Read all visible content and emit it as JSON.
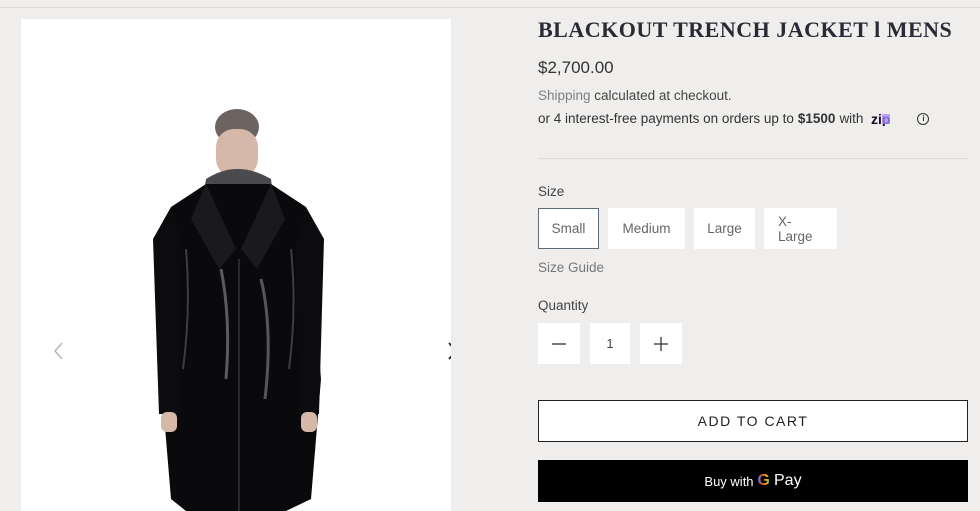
{
  "product": {
    "title": "BLACKOUT TRENCH JACKET l MENS",
    "price": "$2,700.00",
    "shipping_link": "Shipping",
    "shipping_text": " calculated at checkout.",
    "zip_prefix": "or 4 interest-free payments on orders up to",
    "zip_amount": "$1500",
    "zip_suffix": "with",
    "zip_brand": "zip"
  },
  "size": {
    "label": "Size",
    "options": [
      "Small",
      "Medium",
      "Large",
      "X-Large"
    ],
    "selected": "Small",
    "guide_label": "Size Guide"
  },
  "quantity": {
    "label": "Quantity",
    "value": "1",
    "minus": "−",
    "plus": "+"
  },
  "actions": {
    "add_to_cart": "ADD TO CART",
    "buy_with": "Buy with",
    "gpay_g": "G",
    "gpay_pay": "Pay"
  },
  "gallery": {
    "prev_icon": "chevron-left-icon",
    "next_icon": "chevron-right-icon"
  },
  "colors": {
    "page_bg": "#efeeec",
    "accent_border": "#5d6c78",
    "zip_purple": "#a88bff",
    "gpay_bg": "#000000"
  }
}
